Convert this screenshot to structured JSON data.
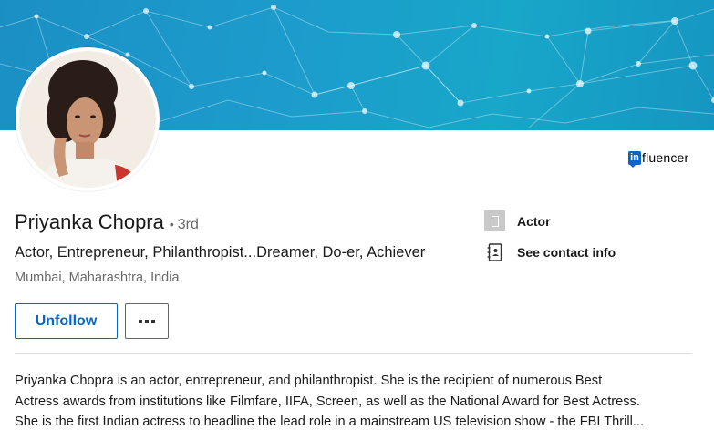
{
  "banner": {
    "color": "#1b9ac9"
  },
  "profile": {
    "name": "Priyanka Chopra",
    "separator": "•",
    "degree": "3rd",
    "headline": "Actor, Entrepreneur, Philanthropist...Dreamer, Do-er, Achiever",
    "location": "Mumbai, Maharashtra, India",
    "badge": {
      "logo_text": "in",
      "label": "fluencer"
    }
  },
  "sidebar": {
    "work": {
      "icon": "company-logo-icon",
      "label": "Actor"
    },
    "contact": {
      "icon": "contact-card-icon",
      "label": "See contact info"
    }
  },
  "actions": {
    "unfollow_label": "Unfollow",
    "more_icon": "more-horizontal-icon"
  },
  "about": {
    "lines": [
      "Priyanka Chopra is an actor, entrepreneur, and philanthropist. She is the recipient of numerous Best",
      "Actress awards from institutions like Filmfare, IIFA, Screen, as well as the National Award for Best Actress.",
      "She is the first Indian actress to headline the lead role in a mainstream US television show - the FBI Thrill..."
    ]
  },
  "colors": {
    "accent": "#0a66c2",
    "banner": "#1b9ac9",
    "muted": "#666666"
  }
}
